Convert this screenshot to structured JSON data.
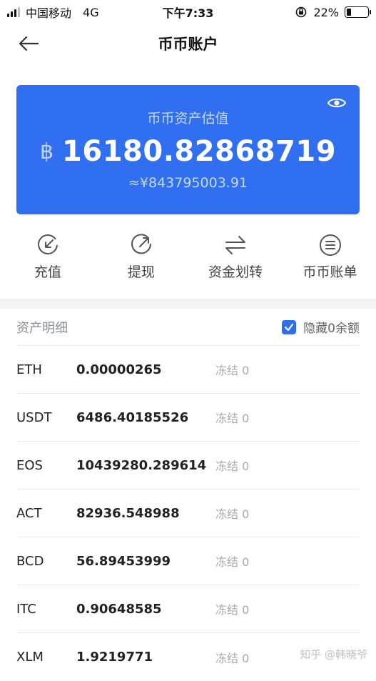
{
  "status_bar": {
    "carrier": "中国移动",
    "network": "4G",
    "time": "下午7:33",
    "battery": "22%",
    "battery_level": 0.22
  },
  "header": {
    "title": "币币账户",
    "back_icon": "arrow-left-icon"
  },
  "balance_card": {
    "label": "币币资产估值",
    "currency_symbol": "฿",
    "value": "16180.82868719",
    "cny_value": "≈¥843795003.91",
    "accent_color": "#2f6ff0"
  },
  "actions": [
    {
      "label": "充值",
      "icon": "deposit-icon"
    },
    {
      "label": "提现",
      "icon": "withdraw-icon"
    },
    {
      "label": "资金划转",
      "icon": "transfer-icon"
    },
    {
      "label": "币币账单",
      "icon": "bill-icon"
    }
  ],
  "asset_section": {
    "title": "资产明细",
    "hide_zero_label": "隐藏0余额",
    "hide_zero_checked": true
  },
  "assets": [
    {
      "symbol": "ETH",
      "amount": "0.00000265",
      "frozen": "冻结 0"
    },
    {
      "symbol": "USDT",
      "amount": "6486.40185526",
      "frozen": "冻结 0"
    },
    {
      "symbol": "EOS",
      "amount": "10439280.289614",
      "frozen": "冻结 0"
    },
    {
      "symbol": "ACT",
      "amount": "82936.548988",
      "frozen": "冻结 0"
    },
    {
      "symbol": "BCD",
      "amount": "56.89453999",
      "frozen": "冻结 0"
    },
    {
      "symbol": "ITC",
      "amount": "0.90648585",
      "frozen": "冻结 0"
    },
    {
      "symbol": "XLM",
      "amount": "1.9219771",
      "frozen": "冻结 0"
    }
  ],
  "watermark": {
    "text": "知乎 @韩晓爷"
  }
}
